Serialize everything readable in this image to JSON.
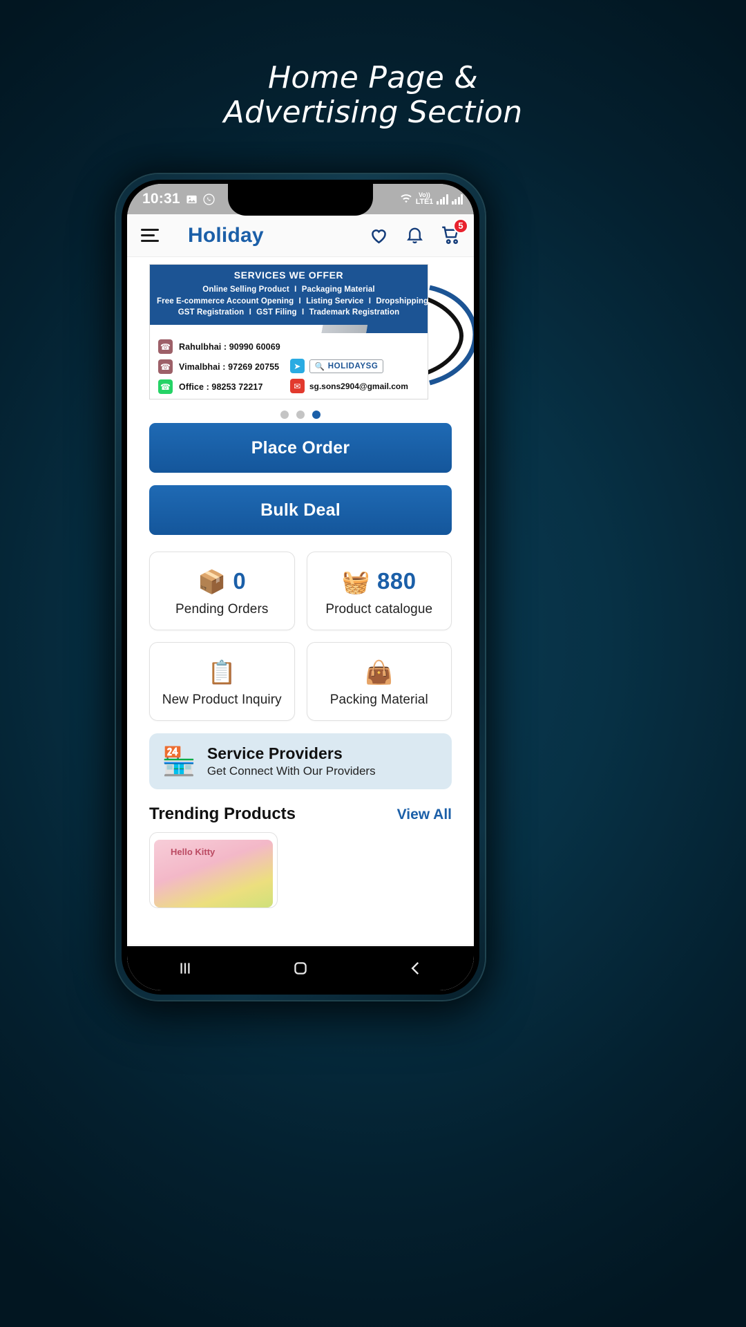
{
  "page": {
    "title_line1": "Home Page &",
    "title_line2": "Advertising Section"
  },
  "status_bar": {
    "time": "10:31",
    "icons": [
      "image-icon",
      "whatsapp-icon",
      "wifi-icon"
    ],
    "network_line1": "Vo))",
    "network_line2": "LTE1"
  },
  "app_bar": {
    "menu_icon": "hamburger-menu-icon",
    "brand": "Holiday",
    "wishlist_icon": "heart-icon",
    "notification_icon": "bell-icon",
    "cart_icon": "shopping-cart-icon",
    "cart_badge": "5"
  },
  "banner": {
    "heading": "SERVICES WE OFFER",
    "services_line1": [
      "Online Selling Product",
      "Packaging Material"
    ],
    "services_line2": [
      "Free E-commerce Account Opening",
      "Listing Service",
      "Dropshipping"
    ],
    "services_line3": [
      "GST Registration",
      "GST Filing",
      "Trademark Registration"
    ],
    "separator": "I",
    "contacts": [
      {
        "icon": "phone-icon",
        "text": "Rahulbhai : 90990 60069"
      },
      {
        "icon": "phone-icon",
        "text": "Vimalbhai : 97269 20755"
      },
      {
        "icon": "whatsapp-icon",
        "text": "Office :      98253 72217"
      }
    ],
    "telegram": {
      "icon": "telegram-icon",
      "search_icon": "search-icon",
      "handle": "HOLIDAYSG"
    },
    "email": {
      "icon": "email-icon",
      "address": "sg.sons2904@gmail.com"
    },
    "dots": {
      "count": 3,
      "active_index": 2
    }
  },
  "actions": {
    "place_order": "Place Order",
    "bulk_deal": "Bulk Deal"
  },
  "stat_cells": [
    {
      "emoji": "📦",
      "icon_name": "package-clock-icon",
      "value": "0",
      "label": "Pending Orders"
    },
    {
      "emoji": "🧺",
      "icon_name": "shopping-basket-icon",
      "value": "880",
      "label": "Product catalogue"
    },
    {
      "emoji": "📋",
      "icon_name": "clipboard-pencil-icon",
      "value": "",
      "label": "New Product Inquiry"
    },
    {
      "emoji": "👜",
      "icon_name": "handbag-icon",
      "value": "",
      "label": "Packing Material"
    }
  ],
  "service_providers": {
    "emoji": "🏪",
    "icon_name": "storefront-icon",
    "title": "Service Providers",
    "subtitle": "Get Connect With Our Providers"
  },
  "trending": {
    "title": "Trending Products",
    "view_all": "View All"
  },
  "bottom_nav": [
    {
      "icon": "home-icon",
      "active": true
    },
    {
      "icon": "bag-check-icon",
      "active": false
    },
    {
      "icon": "grid-dashboard-icon",
      "active": false
    },
    {
      "icon": "service-hand-icon",
      "active": false
    },
    {
      "icon": "offer-tags-icon",
      "active": false
    }
  ],
  "android_nav": [
    {
      "icon": "recents-icon"
    },
    {
      "icon": "home-circle-icon"
    },
    {
      "icon": "back-icon"
    }
  ],
  "colors": {
    "background": "#06293c",
    "brand_blue": "#1b5fa8",
    "button_blue": "#14569b",
    "banner_blue": "#1c5494",
    "badge_red": "#e8222e",
    "sp_bg": "#dbe9f2"
  }
}
